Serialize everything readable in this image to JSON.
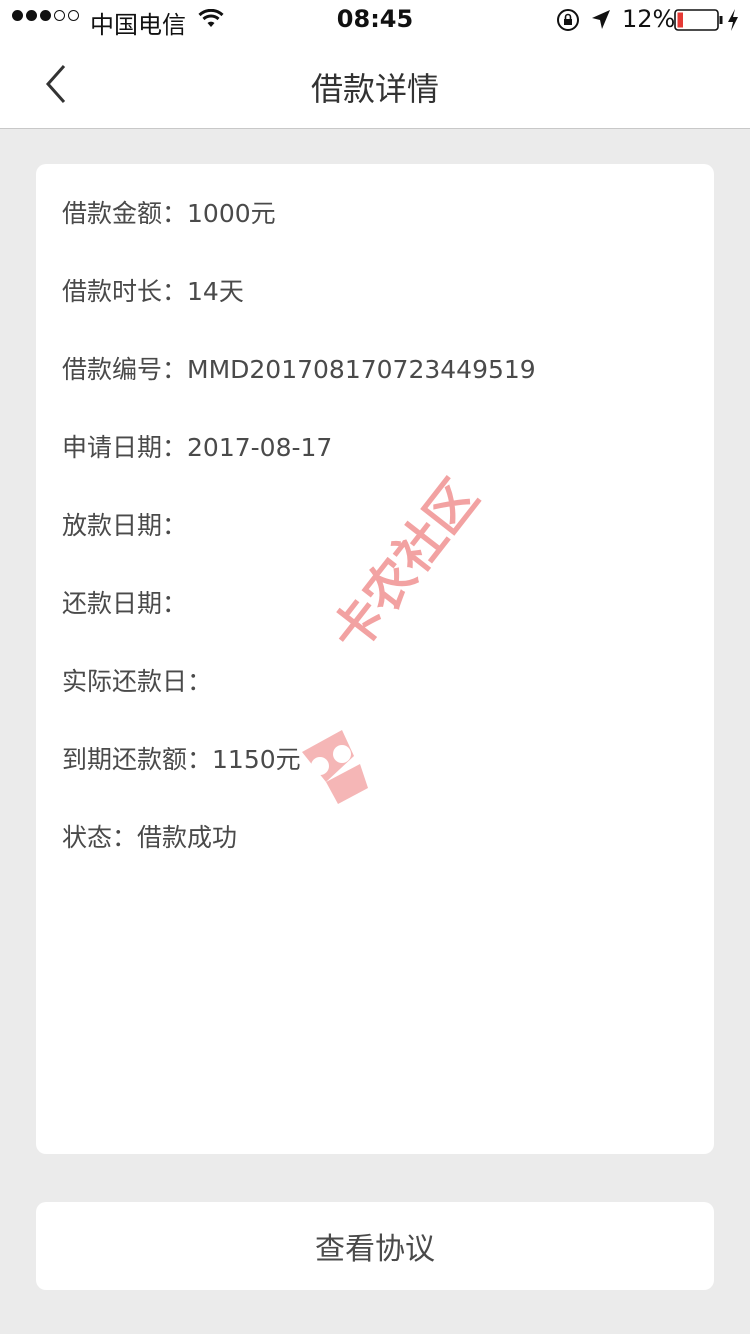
{
  "status_bar": {
    "carrier": "中国电信",
    "time": "08:45",
    "battery_percent": "12%",
    "icons": [
      "wifi-icon",
      "orientation-lock-icon",
      "location-arrow-icon",
      "battery-icon",
      "charging-icon"
    ]
  },
  "nav": {
    "title": "借款详情",
    "back_icon": "chevron-left-icon"
  },
  "details": [
    {
      "label": "借款金额：",
      "value": "1000元"
    },
    {
      "label": "借款时长：",
      "value": "14天"
    },
    {
      "label": "借款编号：",
      "value": "MMD201708170723449519"
    },
    {
      "label": "申请日期：",
      "value": "2017-08-17"
    },
    {
      "label": "放款日期：",
      "value": ""
    },
    {
      "label": "还款日期：",
      "value": ""
    },
    {
      "label": "实际还款日：",
      "value": ""
    },
    {
      "label": "到期还款额：",
      "value": "1150元"
    },
    {
      "label": "状态：",
      "value": "借款成功"
    }
  ],
  "watermark": "卡农社区",
  "actions": {
    "view_agreement": "查看协议"
  },
  "colors": {
    "background": "#ebebeb",
    "card": "#ffffff",
    "text": "#4a4a4a",
    "battery_low": "#e53935",
    "watermark": "#f08c8c"
  }
}
